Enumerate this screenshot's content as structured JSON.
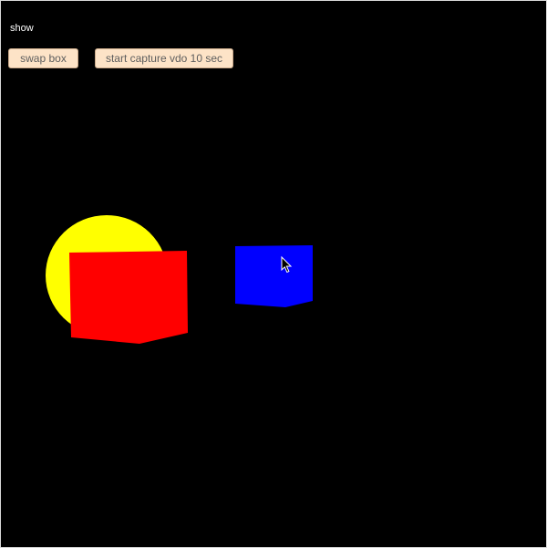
{
  "status": {
    "text": "show"
  },
  "toolbar": {
    "swap_label": "swap box",
    "capture_label": "start capture vdo 10 sec"
  },
  "scene": {
    "background": "#000000",
    "objects": [
      {
        "name": "yellow-sphere",
        "color": "#ffff00"
      },
      {
        "name": "red-box",
        "color": "#ff0000"
      },
      {
        "name": "blue-box",
        "color": "#0000ff"
      }
    ],
    "cursor": "arrow-cursor"
  }
}
